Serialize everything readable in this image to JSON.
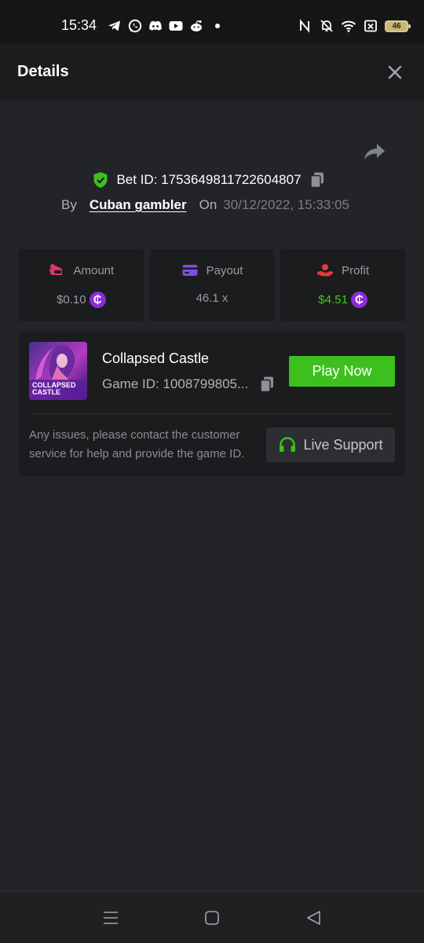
{
  "status_bar": {
    "time": "15:34",
    "battery": "46",
    "left_icons": [
      "telegram-icon",
      "whatsapp-icon",
      "discord-icon",
      "youtube-icon",
      "reddit-icon",
      "dot-icon"
    ],
    "right_icons": [
      "nfc-icon",
      "bell-off-icon",
      "wifi-icon",
      "sim-x-icon",
      "battery-icon"
    ]
  },
  "header": {
    "title": "Details",
    "close_icon": "close-icon"
  },
  "share_icon": "share-icon",
  "bet": {
    "id_label": "Bet ID: 1753649811722604807",
    "by_label": "By",
    "username": "Cuban gambler",
    "on_label": "On",
    "date": "30/12/2022, 15:33:05"
  },
  "stats": [
    {
      "label": "Amount",
      "value": "$0.10",
      "icon": "amount-icon",
      "coin": true,
      "coin_symbol": "₵"
    },
    {
      "label": "Payout",
      "value": "46.1 x",
      "icon": "payout-card-icon",
      "coin": false
    },
    {
      "label": "Profit",
      "value": "$4.51",
      "icon": "profit-icon",
      "coin": true,
      "coin_symbol": "₵"
    }
  ],
  "game": {
    "name": "Collapsed Castle",
    "id": "Game ID: 1008799805...",
    "thumb_text_1": "COLLAPSED",
    "thumb_text_2": "CASTLE",
    "play_label": "Play Now",
    "issue_text": "Any issues, please contact the customer service for help and provide the game ID.",
    "support_label": "Live Support"
  },
  "colors": {
    "background": "#232427",
    "card": "#1b1c1e",
    "accent_green": "#3dbf1e",
    "profit_green": "#47c81e",
    "coin_purple": "#8b2bd9",
    "amount_pink": "#e0336b",
    "payout_purple": "#7c4ee4",
    "profit_red": "#e5393c"
  },
  "nav": {
    "icons": [
      "recent-apps-icon",
      "home-icon",
      "back-icon"
    ]
  }
}
